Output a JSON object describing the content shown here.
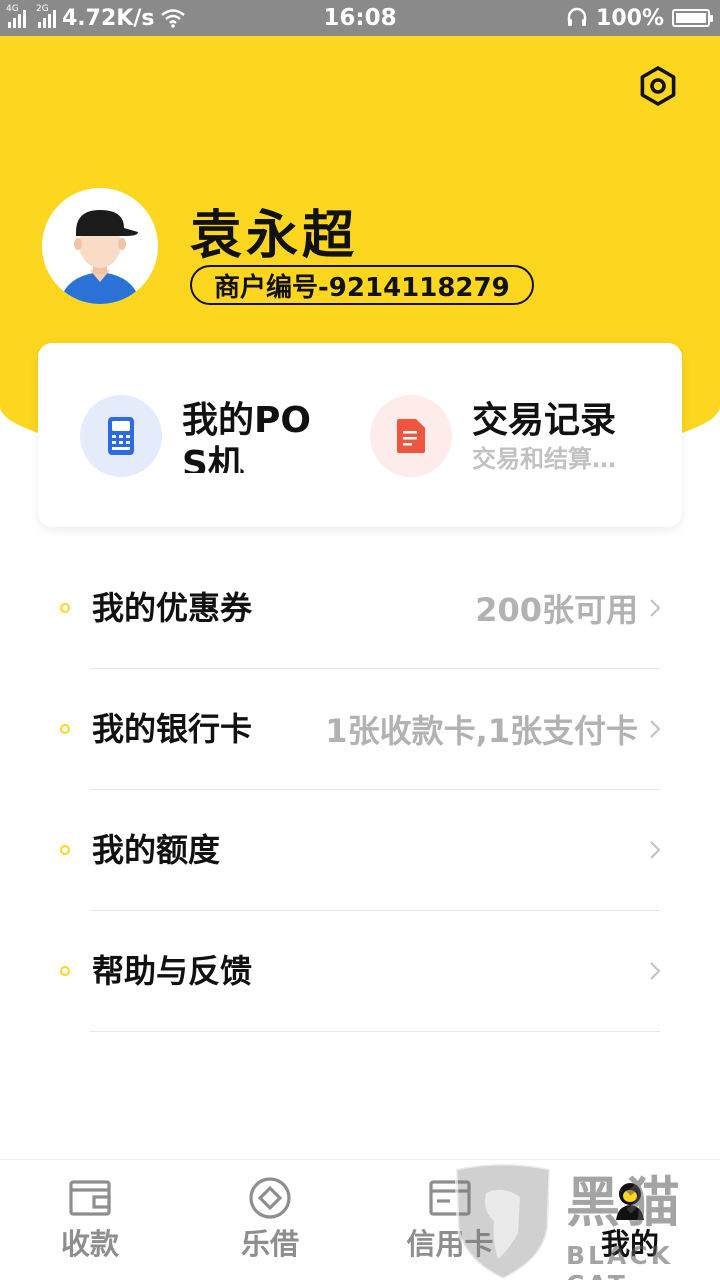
{
  "status_bar": {
    "net1": "4G",
    "net2": "2G",
    "speed": "4.72K/s",
    "time": "16:08",
    "battery_pct": "100%"
  },
  "header": {
    "settings_icon": "settings-hexagon-icon",
    "user_name": "袁永超",
    "merchant_no": "商户编号-9214118279",
    "accent_color": "#fdd61f"
  },
  "shortcuts": [
    {
      "title": "我的POS机",
      "subtitle": "",
      "icon": "pos-terminal-icon",
      "color": "#2d6be4"
    },
    {
      "title": "交易记录",
      "subtitle": "交易和结算明细",
      "icon": "document-icon",
      "color": "#f0553f"
    }
  ],
  "menu": [
    {
      "label": "我的优惠券",
      "value": "200张可用"
    },
    {
      "label": "我的银行卡",
      "value": "1张收款卡,1张支付卡"
    },
    {
      "label": "我的额度",
      "value": ""
    },
    {
      "label": "帮助与反馈",
      "value": ""
    }
  ],
  "nav": [
    {
      "label": "收款",
      "icon": "wallet-icon"
    },
    {
      "label": "乐借",
      "icon": "loan-coin-icon"
    },
    {
      "label": "信用卡",
      "icon": "credit-card-icon"
    },
    {
      "label": "我的",
      "icon": "profile-icon",
      "active": true
    }
  ],
  "watermark": {
    "cn": "黑猫",
    "en": "BLACK CAT"
  }
}
